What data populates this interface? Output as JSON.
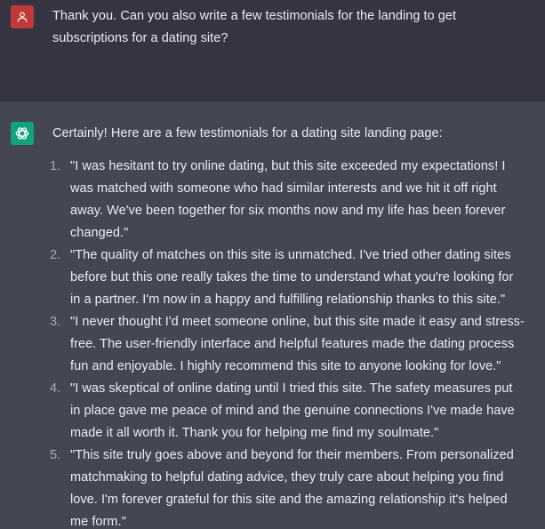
{
  "user_message": {
    "avatar_icon": "user-icon",
    "avatar_color": "#c0393b",
    "text": "Thank you. Can you also write a few testimonials for the landing to get subscriptions for a dating site?"
  },
  "assistant_message": {
    "avatar_icon": "openai-logo-icon",
    "avatar_color": "#10a37f",
    "intro": "Certainly! Here are a few testimonials for a dating site landing page:",
    "items": [
      {
        "number": "1.",
        "text": "\"I was hesitant to try online dating, but this site exceeded my expectations! I was matched with someone who had similar interests and we hit it off right away. We've been together for six months now and my life has been forever changed.\""
      },
      {
        "number": "2.",
        "text": "\"The quality of matches on this site is unmatched. I've tried other dating sites before but this one really takes the time to understand what you're looking for in a partner. I'm now in a happy and fulfilling relationship thanks to this site.\""
      },
      {
        "number": "3.",
        "text": "\"I never thought I'd meet someone online, but this site made it easy and stress-free. The user-friendly interface and helpful features made the dating process fun and enjoyable. I highly recommend this site to anyone looking for love.\""
      },
      {
        "number": "4.",
        "text": "\"I was skeptical of online dating until I tried this site. The safety measures put in place gave me peace of mind and the genuine connections I've made have made it all worth it. Thank you for helping me find my soulmate.\""
      },
      {
        "number": "5.",
        "text": "\"This site truly goes above and beyond for their members. From personalized matchmaking to helpful dating advice, they truly care about helping you find love. I'm forever grateful for this site and the amazing relationship it's helped me form.\""
      }
    ]
  }
}
